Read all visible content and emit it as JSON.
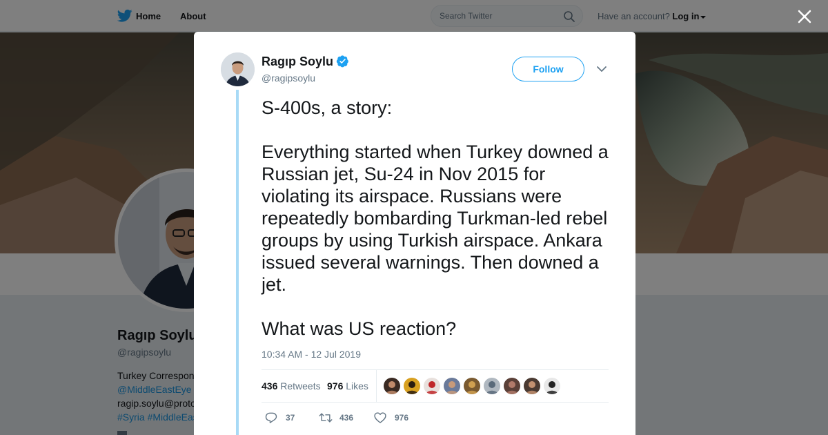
{
  "nav": {
    "home_label": "Home",
    "about_label": "About",
    "search_placeholder": "Search Twitter",
    "have_account_text": "Have an account?",
    "login_label": "Log in"
  },
  "profile": {
    "name": "Ragıp Soylu",
    "handle": "@ragipsoylu",
    "bio_lines": [
      {
        "text": "Turkey Correspon",
        "is_link": false
      },
      {
        "text": "@MiddleEastEye",
        "is_link": true
      },
      {
        "text": "ragip.soylu@proto",
        "is_link": false
      },
      {
        "text": "#Syria #MiddleEas",
        "is_link": true
      }
    ]
  },
  "tweet": {
    "author_name": "Ragıp Soylu",
    "author_handle": "@ragipsoylu",
    "verified": true,
    "follow_label": "Follow",
    "paragraphs": [
      "S-400s, a story:",
      "Everything started when Turkey downed a Russian jet, Su-24 in Nov 2015 for violating its airspace. Russians were repeatedly bombarding Turkman-led rebel groups by using Turkish airspace. Ankara issued several warnings. Then downed a jet.",
      "What was US reaction?"
    ],
    "timestamp": "10:34 AM - 12 Jul 2019",
    "retweets_count": "436",
    "retweets_label": "Retweets",
    "likes_count": "976",
    "likes_label": "Likes",
    "liker_avatar_count": 9,
    "replies_count": "37",
    "retweet_action_count": "436",
    "like_action_count": "976"
  },
  "colors": {
    "accent": "#1da1f2",
    "thread_line": "#a8daf6",
    "link": "#1b95e0",
    "secondary_text": "#657786"
  },
  "icons": [
    "twitter-bird-icon",
    "search-icon",
    "close-icon",
    "verified-badge-icon",
    "chevron-down-icon",
    "reply-icon",
    "retweet-icon",
    "heart-icon"
  ]
}
